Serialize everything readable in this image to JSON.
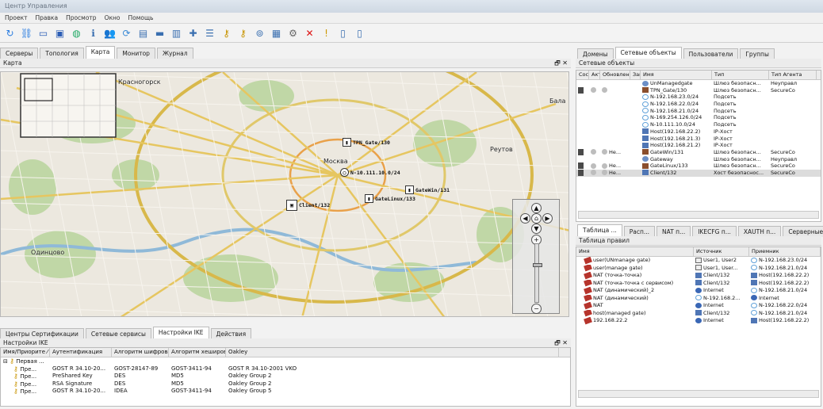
{
  "window": {
    "title": "Центр Управления",
    "right_text": ""
  },
  "menu": [
    "Проект",
    "Правка",
    "Просмотр",
    "Окно",
    "Помощь"
  ],
  "toolbar_icons": [
    "refresh-icon",
    "network-icon",
    "monitor-icon",
    "computer-icon",
    "globe-icon",
    "info-icon",
    "users-icon",
    "sync-icon",
    "document-icon",
    "card-icon",
    "server-icon",
    "puzzle-icon",
    "list-icon",
    "key-icon",
    "key-icon",
    "binoculars-icon",
    "report-icon",
    "gear-icon",
    "delete-icon",
    "exclamation-icon",
    "clipboard-icon",
    "clipboard-icon"
  ],
  "left_tabs": [
    {
      "label": "Серверы",
      "active": false
    },
    {
      "label": "Топология",
      "active": false
    },
    {
      "label": "Карта",
      "active": true
    },
    {
      "label": "Монитор",
      "active": false
    },
    {
      "label": "Журнал",
      "active": false
    }
  ],
  "map_panel": {
    "title": "Карта",
    "controls": "🗗 ✕"
  },
  "map": {
    "labels": [
      "Красногорск",
      "Москва",
      "Реутов",
      "Одинцово",
      "Бала"
    ],
    "nodes": [
      {
        "name": "TPN_Gate/130"
      },
      {
        "name": "N-10.111.10.0/24"
      },
      {
        "name": "GateWin/131"
      },
      {
        "name": "GateLinux/133"
      },
      {
        "name": "Client/132"
      }
    ]
  },
  "bottom_tabs": [
    {
      "label": "Центры Сертификации",
      "active": false
    },
    {
      "label": "Сетевые сервисы",
      "active": false
    },
    {
      "label": "Настройки IKE",
      "active": true
    },
    {
      "label": "Действия",
      "active": false
    }
  ],
  "ike_panel": {
    "title": "Настройки IKE",
    "controls": "🗗 ✕",
    "columns": [
      "Имя/Приорите ⁄",
      "Аутентификация",
      "Алгоритм шифров.",
      "Алгоритм хеширов.",
      "Oakley"
    ],
    "group": "Первая ...",
    "rows": [
      [
        "Пре...",
        "GOST R 34.10-20...",
        "GOST-28147-89",
        "GOST-3411-94",
        "GOST R 34.10-2001 VKO"
      ],
      [
        "Пре...",
        "PreShared Key",
        "DES",
        "MD5",
        "Oakley Group 2"
      ],
      [
        "Пре...",
        "RSA Signature",
        "DES",
        "MD5",
        "Oakley Group 2"
      ],
      [
        "Пре...",
        "GOST R 34.10-20...",
        "IDEA",
        "GOST-3411-94",
        "Oakley Group 5"
      ]
    ]
  },
  "right_tabs": [
    {
      "label": "Домены",
      "active": false
    },
    {
      "label": "Сетевые объекты",
      "active": true
    },
    {
      "label": "Пользователи",
      "active": false
    },
    {
      "label": "Группы",
      "active": false
    }
  ],
  "netobj_panel": {
    "title": "Сетевые объекты",
    "columns": [
      "Сос",
      "Акт",
      "Обновлен",
      "Зам",
      "Имя",
      "Тип",
      "Тип Агента"
    ],
    "rows": [
      {
        "status": "",
        "update": "",
        "icon": "gw",
        "name": "UnManagedgate",
        "type": "Шлюз безопасн...",
        "agent": "Неуправл",
        "sel": false
      },
      {
        "status": "lock",
        "update": "",
        "icon": "secure",
        "name": "TPN_Gate/130",
        "type": "Шлюз безопасн...",
        "agent": "SecureCo",
        "sel": false
      },
      {
        "status": "",
        "update": "",
        "icon": "net",
        "name": "N-192.168.23.0/24",
        "type": "Подсеть",
        "agent": "",
        "sel": false
      },
      {
        "status": "",
        "update": "",
        "icon": "net",
        "name": "N-192.168.22.0/24",
        "type": "Подсеть",
        "agent": "",
        "sel": false
      },
      {
        "status": "",
        "update": "",
        "icon": "net",
        "name": "N-192.168.21.0/24",
        "type": "Подсеть",
        "agent": "",
        "sel": false
      },
      {
        "status": "",
        "update": "",
        "icon": "net",
        "name": "N-169.254.126.0/24",
        "type": "Подсеть",
        "agent": "",
        "sel": false
      },
      {
        "status": "",
        "update": "",
        "icon": "net",
        "name": "N-10.111.10.0/24",
        "type": "Подсеть",
        "agent": "",
        "sel": false
      },
      {
        "status": "",
        "update": "",
        "icon": "host",
        "name": "Host(192.168.22.2)",
        "type": "IP-Хост",
        "agent": "",
        "sel": false
      },
      {
        "status": "",
        "update": "",
        "icon": "host",
        "name": "Host(192.168.21.3)",
        "type": "IP-Хост",
        "agent": "",
        "sel": false
      },
      {
        "status": "",
        "update": "",
        "icon": "host",
        "name": "Host(192.168.21.2)",
        "type": "IP-Хост",
        "agent": "",
        "sel": false
      },
      {
        "status": "lock",
        "update": "Не...",
        "icon": "secure",
        "name": "GateWin/131",
        "type": "Шлюз безопасн...",
        "agent": "SecureCo",
        "sel": false
      },
      {
        "status": "",
        "update": "",
        "icon": "gw",
        "name": "Gateway",
        "type": "Шлюз безопасн...",
        "agent": "Неуправл",
        "sel": false
      },
      {
        "status": "lock",
        "update": "Не...",
        "icon": "secure",
        "name": "GateLinux/133",
        "type": "Шлюз безопасн...",
        "agent": "SecureCo",
        "sel": false
      },
      {
        "status": "lock",
        "update": "Не...",
        "icon": "host",
        "name": "Client/132",
        "type": "Хост безопаснос...",
        "agent": "SecureCo",
        "sel": true
      }
    ]
  },
  "rules_tabs": [
    {
      "label": "Таблица ...",
      "active": true
    },
    {
      "label": "Расп...",
      "active": false
    },
    {
      "label": "NAT п...",
      "active": false
    },
    {
      "label": "IKECFG п...",
      "active": false
    },
    {
      "label": "XAUTH п...",
      "active": false
    },
    {
      "label": "Серверные п...",
      "active": false
    }
  ],
  "rules_panel": {
    "title": "Таблица правил",
    "columns": [
      "Имя",
      "Источник",
      "Приемник"
    ],
    "rows": [
      {
        "name": "user(UNmanage gate)",
        "src_icon": "user",
        "src": "User1, User2",
        "dst_icon": "net",
        "dst": "N-192.168.23.0/24"
      },
      {
        "name": "user(manage gate)",
        "src_icon": "user",
        "src": "User1, User...",
        "dst_icon": "net",
        "dst": "N-192.168.21.0/24"
      },
      {
        "name": "NAT (точка-точка)",
        "src_icon": "host",
        "src": "Client/132",
        "dst_icon": "host",
        "dst": "Host(192.168.22.2)"
      },
      {
        "name": "NAT (точка-точка с сервисом)",
        "src_icon": "host",
        "src": "Client/132",
        "dst_icon": "host",
        "dst": "Host(192.168.22.2)"
      },
      {
        "name": "NAT (динамический)_2",
        "src_icon": "world",
        "src": "Internet",
        "dst_icon": "net",
        "dst": "N-192.168.21.0/24"
      },
      {
        "name": "NAT (динамический)",
        "src_icon": "net",
        "src": "N-192.168.2...",
        "dst_icon": "world",
        "dst": "Internet"
      },
      {
        "name": "NAT",
        "src_icon": "world",
        "src": "Internet",
        "dst_icon": "net",
        "dst": "N-192.168.22.0/24"
      },
      {
        "name": "host(managed gate)",
        "src_icon": "host",
        "src": "Client/132",
        "dst_icon": "net",
        "dst": "N-192.168.21.0/24"
      },
      {
        "name": "192.168.22.2",
        "src_icon": "world",
        "src": "Internet",
        "dst_icon": "host",
        "dst": "Host(192.168.22.2)"
      }
    ]
  }
}
